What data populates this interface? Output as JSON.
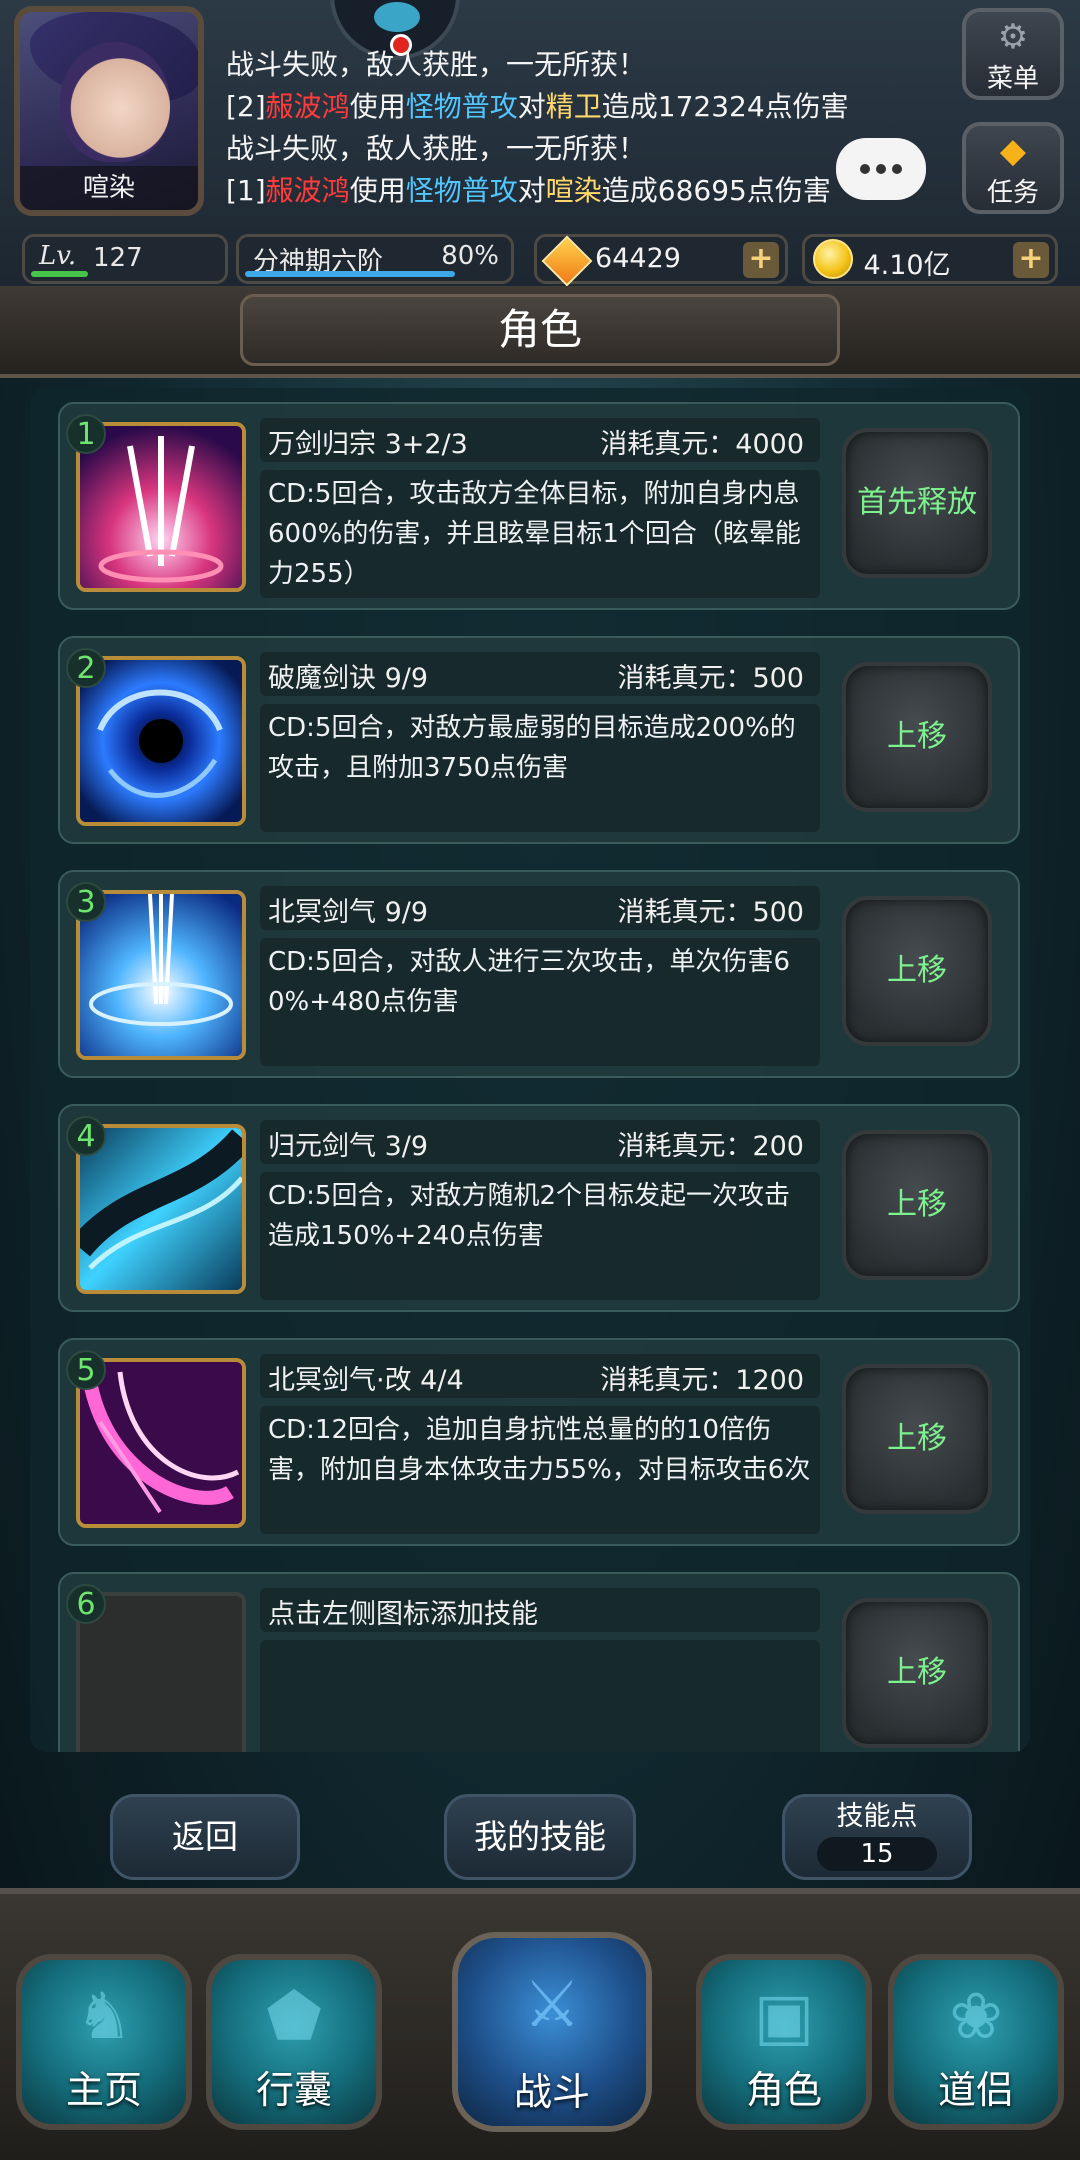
{
  "player": {
    "name": "喧染",
    "level_label": "Lv.",
    "level": "127",
    "level_progress": 0.3,
    "realm": "分神期六阶",
    "realm_progress_text": "80%",
    "realm_progress": 0.8
  },
  "battle_log": [
    {
      "parts": [
        {
          "t": "战斗失败，敌人获胜，一无所获！",
          "c": ""
        }
      ]
    },
    {
      "parts": [
        {
          "t": "[2]",
          "c": ""
        },
        {
          "t": "赧波鸿",
          "c": "red"
        },
        {
          "t": "使用",
          "c": ""
        },
        {
          "t": "怪物普攻",
          "c": "blue"
        },
        {
          "t": "对",
          "c": ""
        },
        {
          "t": "精卫",
          "c": "yellow"
        },
        {
          "t": "造成172324点伤害",
          "c": ""
        }
      ]
    },
    {
      "parts": [
        {
          "t": "战斗失败，敌人获胜，一无所获！",
          "c": ""
        }
      ]
    },
    {
      "parts": [
        {
          "t": "[1]",
          "c": ""
        },
        {
          "t": "赧波鸿",
          "c": "red"
        },
        {
          "t": "使用",
          "c": ""
        },
        {
          "t": "怪物普攻",
          "c": "blue"
        },
        {
          "t": "对",
          "c": ""
        },
        {
          "t": "喧染",
          "c": "yellow"
        },
        {
          "t": "造成68695点伤害",
          "c": ""
        }
      ]
    }
  ],
  "side_buttons": {
    "menu": "菜单",
    "task": "任务"
  },
  "currency": {
    "gems": "64429",
    "gold": "4.10亿",
    "plus": "+"
  },
  "page_title": "角色",
  "skills": [
    {
      "num": "1",
      "name": "万剑归宗 3+2/3",
      "cost": "消耗真元：4000",
      "desc": "CD:5回合，攻击敌方全体目标，附加自身内息600%的伤害，并且眩晕目标1个回合（眩晕能力255）",
      "button": "首先释放",
      "icon": "sword-rain"
    },
    {
      "num": "2",
      "name": "破魔剑诀 9/9",
      "cost": "消耗真元：500",
      "desc": "CD:5回合，对敌方最虚弱的目标造成200%的攻击，且附加3750点伤害",
      "button": "上移",
      "icon": "vortex"
    },
    {
      "num": "3",
      "name": "北冥剑气 9/9",
      "cost": "消耗真元：500",
      "desc": "CD:5回合，对敌人进行三次攻击，单次伤害60%+480点伤害",
      "button": "上移",
      "icon": "light-burst"
    },
    {
      "num": "4",
      "name": "归元剑气 3/9",
      "cost": "消耗真元：200",
      "desc": "CD:5回合，对敌方随机2个目标发起一次攻击造成150%+240点伤害",
      "button": "上移",
      "icon": "ice-slash"
    },
    {
      "num": "5",
      "name": "北冥剑气·改 4/4",
      "cost": "消耗真元：1200",
      "desc": "CD:12回合，追加自身抗性总量的的10倍伤害，附加自身本体攻击力55%，对目标攻击6次",
      "button": "上移",
      "icon": "pink-slash"
    },
    {
      "num": "6",
      "name": "点击左侧图标添加技能",
      "cost": "",
      "desc": "",
      "button": "上移",
      "icon": "empty"
    }
  ],
  "actions": {
    "back": "返回",
    "my_skills": "我的技能",
    "skill_points_label": "技能点",
    "skill_points": "15"
  },
  "nav": {
    "home": "主页",
    "bag": "行囊",
    "battle": "战斗",
    "role": "角色",
    "dao": "道侣"
  }
}
